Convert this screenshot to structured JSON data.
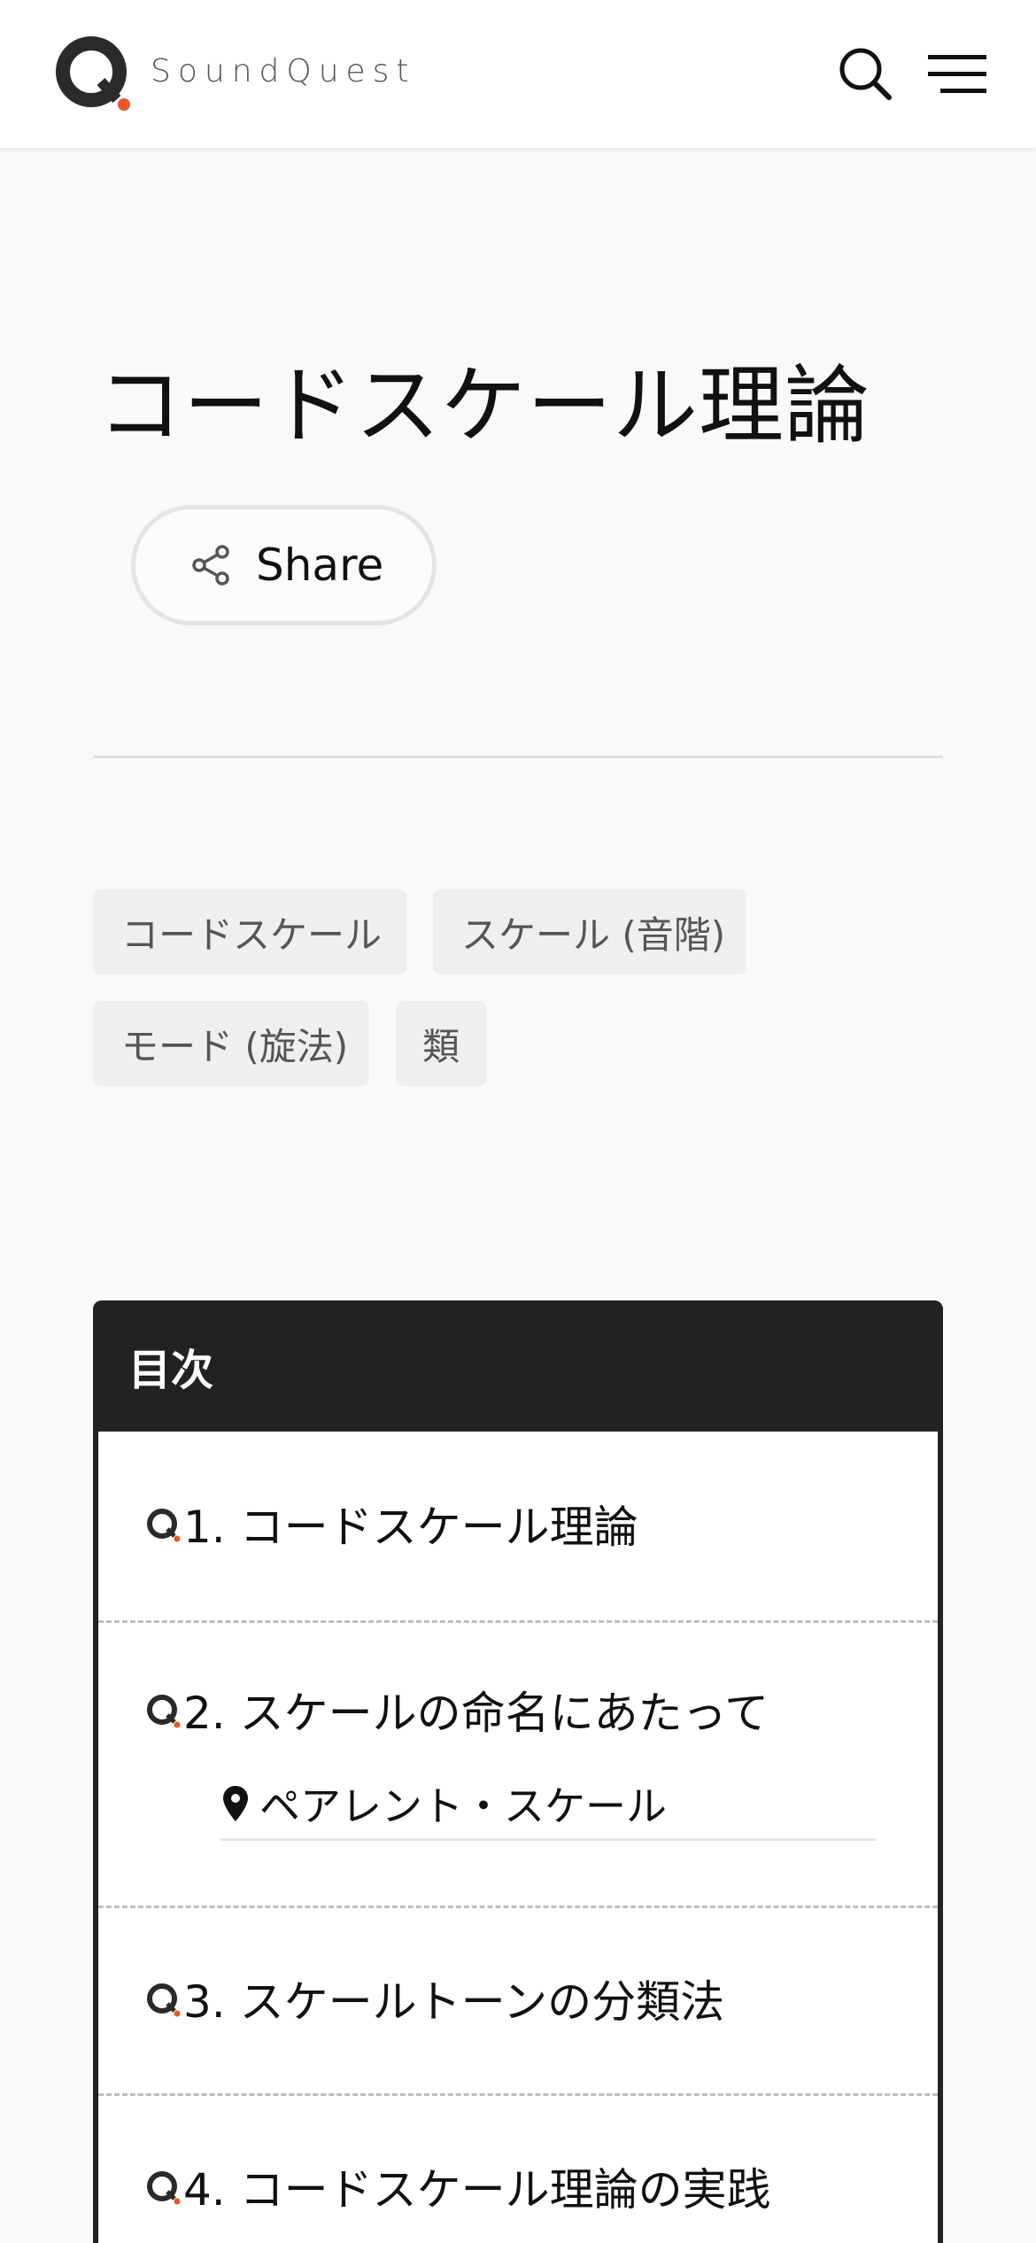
{
  "header": {
    "brand": "SoundQuest",
    "accent": "#e8572a"
  },
  "article": {
    "title": "コードスケール理論",
    "share_label": "Share"
  },
  "tags": [
    "コードスケール",
    "スケール (音階)",
    "モード (旋法)",
    "類"
  ],
  "toc": {
    "heading": "目次",
    "items": [
      {
        "label": "1. コードスケール理論"
      },
      {
        "label": "2. スケールの命名にあたって",
        "sub": "ペアレント・スケール"
      },
      {
        "label": "3. スケールトーンの分類法"
      },
      {
        "label": "4. コードスケール理論の実践"
      }
    ]
  }
}
